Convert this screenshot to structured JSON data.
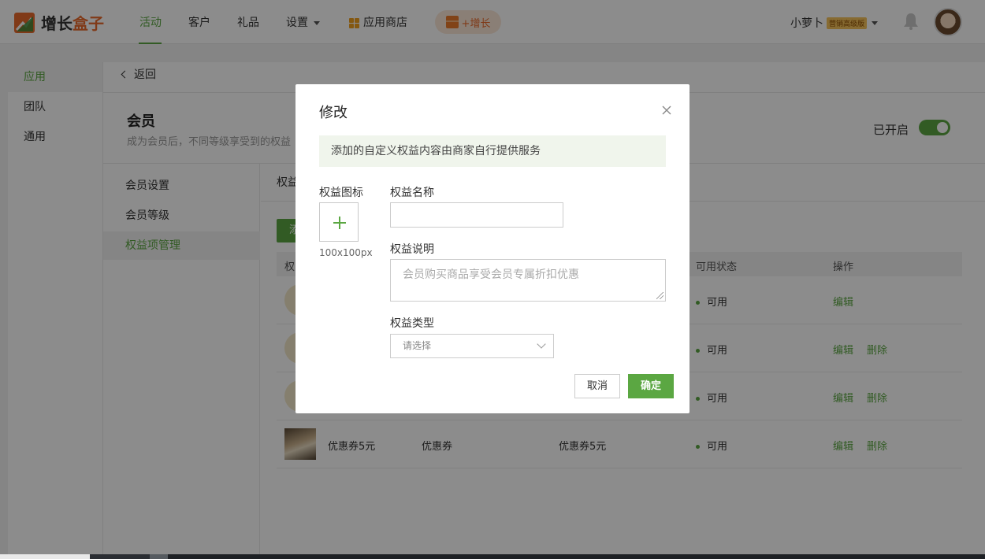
{
  "brand": {
    "name_part1": "增长",
    "name_part2": "盒子"
  },
  "nav": {
    "items": [
      "活动",
      "客户",
      "礼品",
      "设置"
    ],
    "store_label": "应用商店",
    "growth_label": "+增长"
  },
  "user": {
    "name": "小萝卜",
    "badge": "营销高级版"
  },
  "sidebar": {
    "items": [
      "应用",
      "团队",
      "通用"
    ]
  },
  "page": {
    "back_label": "返回",
    "section_title": "会员",
    "section_subtitle": "成为会员后，不同等级享受到的权益",
    "enabled_label": "已开启",
    "enabled": true
  },
  "subnav": {
    "items": [
      "会员设置",
      "会员等级",
      "权益项管理"
    ]
  },
  "table": {
    "tab_label": "权益",
    "add_button_label": "添",
    "headers": {
      "first": "权",
      "status": "可用状态",
      "action": "操作"
    },
    "rows": [
      {
        "name": "",
        "type": "",
        "desc": "",
        "status": "可用",
        "edit": "编辑",
        "delete": ""
      },
      {
        "name": "",
        "type": "",
        "desc": "",
        "status": "可用",
        "edit": "编辑",
        "delete": "删除"
      },
      {
        "name": "",
        "type": "",
        "desc": "",
        "status": "可用",
        "edit": "编辑",
        "delete": "删除"
      },
      {
        "name": "优惠券5元",
        "type": "优惠券",
        "desc": "优惠券5元",
        "status": "可用",
        "edit": "编辑",
        "delete": "删除"
      }
    ]
  },
  "modal": {
    "title": "修改",
    "notice": "添加的自定义权益内容由商家自行提供服务",
    "icon_label": "权益图标",
    "icon_hint": "100x100px",
    "name_label": "权益名称",
    "name_value": "",
    "desc_label": "权益说明",
    "desc_placeholder": "会员购买商品享受会员专属折扣优惠",
    "type_label": "权益类型",
    "type_placeholder": "请选择",
    "cancel_label": "取消",
    "ok_label": "确定"
  },
  "colors": {
    "accent": "#5ba742",
    "brand_orange": "#e96b2d"
  }
}
